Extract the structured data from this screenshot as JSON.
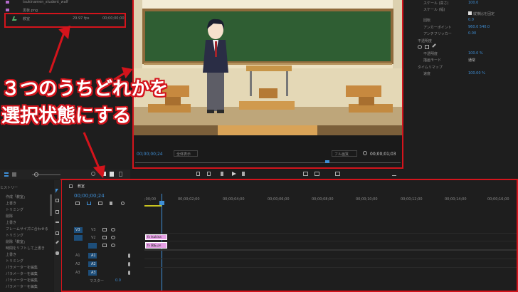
{
  "project": {
    "files": [
      {
        "name": "tsukinamen_student_walf",
        "rate": "",
        "dur": ""
      },
      {
        "name": "黒板.png",
        "rate": "",
        "dur": ""
      },
      {
        "name": "教室",
        "rate": "29.97 fps",
        "dur": "00;00;00;00"
      }
    ]
  },
  "annotation": {
    "line1": "３つのうちどれかを",
    "line2": "選択状態にする"
  },
  "monitor": {
    "timecode": "00;00;00;24",
    "fit": "全体表示",
    "quality": "フル画質",
    "duration": "00;00;01;03"
  },
  "effects": {
    "items": [
      {
        "label": "スケール (高さ)",
        "value": "100.0"
      },
      {
        "label": "スケール (幅)",
        "value": ""
      },
      {
        "label": "縦横比を固定",
        "value": ""
      },
      {
        "label": "回転",
        "value": "0.0"
      },
      {
        "label": "アンカーポイント",
        "value": "960.0   540.0"
      },
      {
        "label": "アンチフリッカー",
        "value": "0.00"
      },
      {
        "label": "不透明度",
        "value": ""
      },
      {
        "label": "不透明度",
        "value": "100.0 %"
      },
      {
        "label": "描画モード",
        "value": "通常"
      },
      {
        "label": "タイムリマップ",
        "value": ""
      },
      {
        "label": "速度",
        "value": "100.00 %"
      }
    ]
  },
  "timeline": {
    "tab": "教室",
    "timecode": "00;00;00;24",
    "ruler": [
      ";00;00",
      "00;00;02;00",
      "00;00;04;00",
      "00;00;06;00",
      "00;00;08;00",
      "00;00;10;00",
      "00;00;12;00",
      "00;00;14;00",
      "00;00;16;00"
    ],
    "video_tracks": [
      "V3",
      "V2",
      "V1"
    ],
    "audio_tracks": [
      "A1",
      "A2",
      "A3"
    ],
    "master_label": "マスター",
    "master_value": "0.0",
    "clips": [
      "fx tsukina",
      "fx 黒板.pn"
    ]
  },
  "history": {
    "header": "ヒストリー",
    "items": [
      "作成「教室」",
      "上書き",
      "トリミング",
      "削除",
      "上書き",
      "フレームサイズに合わせる",
      "トリミング",
      "削除「教室」",
      "時間をリフトして上書き",
      "上書き",
      "トリミング",
      "パラメーターを編集",
      "パラメーターを編集",
      "パラメーターを編集",
      "パラメーターを編集"
    ]
  },
  "colors": {
    "accent": "#3f8fd6",
    "red": "#d4141c",
    "clip": "#e6a0e6"
  }
}
